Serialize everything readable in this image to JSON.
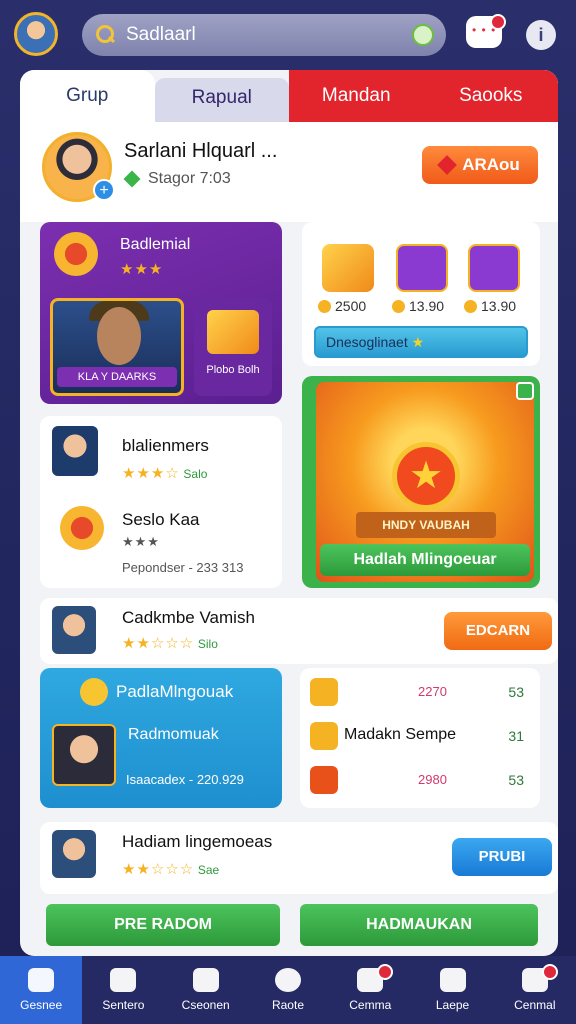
{
  "header": {
    "search_value": "Sadlaarl"
  },
  "tabs": [
    "Grup",
    "Rapual",
    "Mandan",
    "Saooks"
  ],
  "profile": {
    "name": "Sarlani Hlquarl ...",
    "status": "Stagor 7:03",
    "button": "ARAou"
  },
  "purple_panel": {
    "title": "Badlemial",
    "stars": "★★★",
    "thumb_label": "KLA Y DAARKS",
    "side_label": "Plobo Bolh"
  },
  "rewards": {
    "items": [
      {
        "value": "2500"
      },
      {
        "value": "13.90"
      },
      {
        "value": "13.90"
      }
    ],
    "bar": "Dnesoglinaet"
  },
  "ranks": [
    {
      "name": "blalienmers",
      "stars": "★★★☆",
      "tag": "Salo"
    },
    {
      "name": "Seslo Kaa",
      "stars": "★★★",
      "sub": "Pepondser - 233 313"
    }
  ],
  "hadiah": {
    "banner": "HNDY VAUBAH",
    "button": "Hadlah Mlingoeuar"
  },
  "row1": {
    "name": "Cadkmbe Vamish",
    "stars": "★★☆☆☆",
    "tag": "Silo",
    "button": "EDCARN"
  },
  "blue_panel": {
    "title": "PadlaMlngouak",
    "name": "Radmomuak",
    "sub": "Isaacadex - 220.929"
  },
  "list": [
    {
      "name": "",
      "left": "2270",
      "right": "53"
    },
    {
      "name": "Madakn Sempe",
      "left": "",
      "right": "31"
    },
    {
      "name": "",
      "left": "2980",
      "right": "53"
    }
  ],
  "row2": {
    "name": "Hadiam lingemoeas",
    "stars": "★★☆☆☆",
    "tag": "Sae",
    "button": "PRUBI"
  },
  "buttons": {
    "left": "PRE RADOM",
    "right": "HADMAUKAN"
  },
  "nav": [
    "Gesnee",
    "Sentero",
    "Cseonen",
    "Raote",
    "Cemma",
    "Laepe",
    "Cenmal"
  ],
  "colors": {
    "accent_red": "#e2242c",
    "accent_orange": "#f06a14",
    "accent_green": "#3bb24a",
    "accent_blue": "#2fa8e0",
    "purple": "#7c2fb0"
  }
}
